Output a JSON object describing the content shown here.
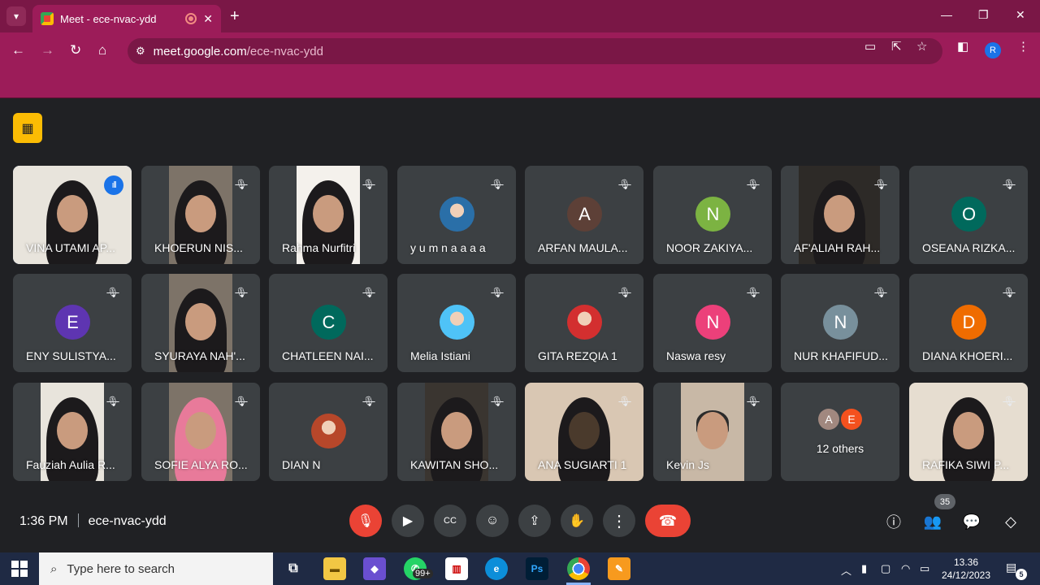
{
  "browser": {
    "tab_title": "Meet - ece-nvac-ydd",
    "url_host": "meet.google.com",
    "url_path": "/ece-nvac-ydd",
    "profile_initial": "R"
  },
  "meet": {
    "participants": [
      {
        "name": "VINA UTAMI AP...",
        "kind": "video",
        "speaking": true
      },
      {
        "name": "KHOERUN NIS...",
        "kind": "video"
      },
      {
        "name": "Rahma Nurfitri",
        "kind": "video"
      },
      {
        "name": "y u m n a a a a",
        "kind": "photo",
        "color": "#2a6fa8"
      },
      {
        "name": "ARFAN MAULA...",
        "kind": "initial",
        "initial": "A",
        "color": "#5d4037"
      },
      {
        "name": "NOOR ZAKIYA...",
        "kind": "initial",
        "initial": "N",
        "color": "#7cb342"
      },
      {
        "name": "AF'ALIAH RAH...",
        "kind": "video"
      },
      {
        "name": "OSEANA RIZKA...",
        "kind": "initial",
        "initial": "O",
        "color": "#00695c"
      },
      {
        "name": "ENY SULISTYA...",
        "kind": "initial",
        "initial": "E",
        "color": "#5e35b1"
      },
      {
        "name": "SYURAYA NAH'...",
        "kind": "video"
      },
      {
        "name": "CHATLEEN NAI...",
        "kind": "initial",
        "initial": "C",
        "color": "#00695c"
      },
      {
        "name": "Melia Istiani",
        "kind": "photo",
        "color": "#4fc3f7"
      },
      {
        "name": "GITA REZQIA 1",
        "kind": "photo",
        "color": "#d32f2f"
      },
      {
        "name": "Naswa resy",
        "kind": "initial",
        "initial": "N",
        "color": "#ec407a"
      },
      {
        "name": "NUR KHAFIFUD...",
        "kind": "initial",
        "initial": "N",
        "color": "#78909c"
      },
      {
        "name": "DIANA KHOERI...",
        "kind": "initial",
        "initial": "D",
        "color": "#ef6c00"
      },
      {
        "name": "Fauziah Aulia R...",
        "kind": "video"
      },
      {
        "name": "SOFIE ALYA RO...",
        "kind": "video"
      },
      {
        "name": "DIAN N",
        "kind": "photo",
        "color": "#b7472a"
      },
      {
        "name": "KAWITAN SHO...",
        "kind": "video"
      },
      {
        "name": "ANA SUGIARTI 1",
        "kind": "video"
      },
      {
        "name": "Kevin Js",
        "kind": "video"
      },
      {
        "name": "12 others",
        "kind": "others",
        "initials": [
          "A",
          "E"
        ],
        "colors": [
          "#a1887f",
          "#f4511e"
        ]
      },
      {
        "name": "RAFIKA SIWI P...",
        "kind": "video"
      }
    ],
    "time": "1:36 PM",
    "meeting_code": "ece-nvac-ydd",
    "participant_count": "35"
  },
  "taskbar": {
    "search_placeholder": "Type here to search",
    "whatsapp_badge": "99+",
    "clock_time": "13.36",
    "clock_date": "24/12/2023",
    "notification_count": "5"
  }
}
